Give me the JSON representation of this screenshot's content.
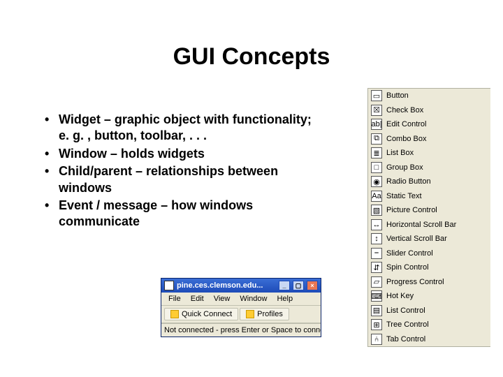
{
  "title": "GUI Concepts",
  "bullets": [
    "Widget – graphic object with functionality; e. g. , button, toolbar, . . .",
    "Window – holds widgets",
    "Child/parent – relationships between windows",
    "Event / message – how windows communicate"
  ],
  "toolbox": [
    {
      "icon": "button-icon",
      "glyph": "▭",
      "label": "Button"
    },
    {
      "icon": "checkbox-icon",
      "glyph": "☒",
      "label": "Check Box"
    },
    {
      "icon": "edit-icon",
      "glyph": "ab|",
      "label": "Edit Control"
    },
    {
      "icon": "combobox-icon",
      "glyph": "⧉",
      "label": "Combo Box"
    },
    {
      "icon": "listbox-icon",
      "glyph": "≣",
      "label": "List Box"
    },
    {
      "icon": "groupbox-icon",
      "glyph": "□",
      "label": "Group Box"
    },
    {
      "icon": "radio-icon",
      "glyph": "◉",
      "label": "Radio Button"
    },
    {
      "icon": "static-text-icon",
      "glyph": "Aa",
      "label": "Static Text"
    },
    {
      "icon": "picture-icon",
      "glyph": "▧",
      "label": "Picture Control"
    },
    {
      "icon": "hscroll-icon",
      "glyph": "↔",
      "label": "Horizontal Scroll Bar"
    },
    {
      "icon": "vscroll-icon",
      "glyph": "↕",
      "label": "Vertical Scroll Bar"
    },
    {
      "icon": "slider-icon",
      "glyph": "⎯",
      "label": "Slider Control"
    },
    {
      "icon": "spin-icon",
      "glyph": "⇵",
      "label": "Spin Control"
    },
    {
      "icon": "progress-icon",
      "glyph": "▱",
      "label": "Progress Control"
    },
    {
      "icon": "hotkey-icon",
      "glyph": "⌨",
      "label": "Hot Key"
    },
    {
      "icon": "list-ctrl-icon",
      "glyph": "▤",
      "label": "List Control"
    },
    {
      "icon": "tree-icon",
      "glyph": "⊞",
      "label": "Tree Control"
    },
    {
      "icon": "tab-icon",
      "glyph": "⑃",
      "label": "Tab Control"
    }
  ],
  "mini_window": {
    "title": "pine.ces.clemson.edu...",
    "menus": [
      "File",
      "Edit",
      "View",
      "Window",
      "Help"
    ],
    "toolbar": [
      {
        "label": "Quick Connect"
      },
      {
        "label": "Profiles"
      }
    ],
    "status_text": "Not connected - press Enter or Space to connec"
  }
}
